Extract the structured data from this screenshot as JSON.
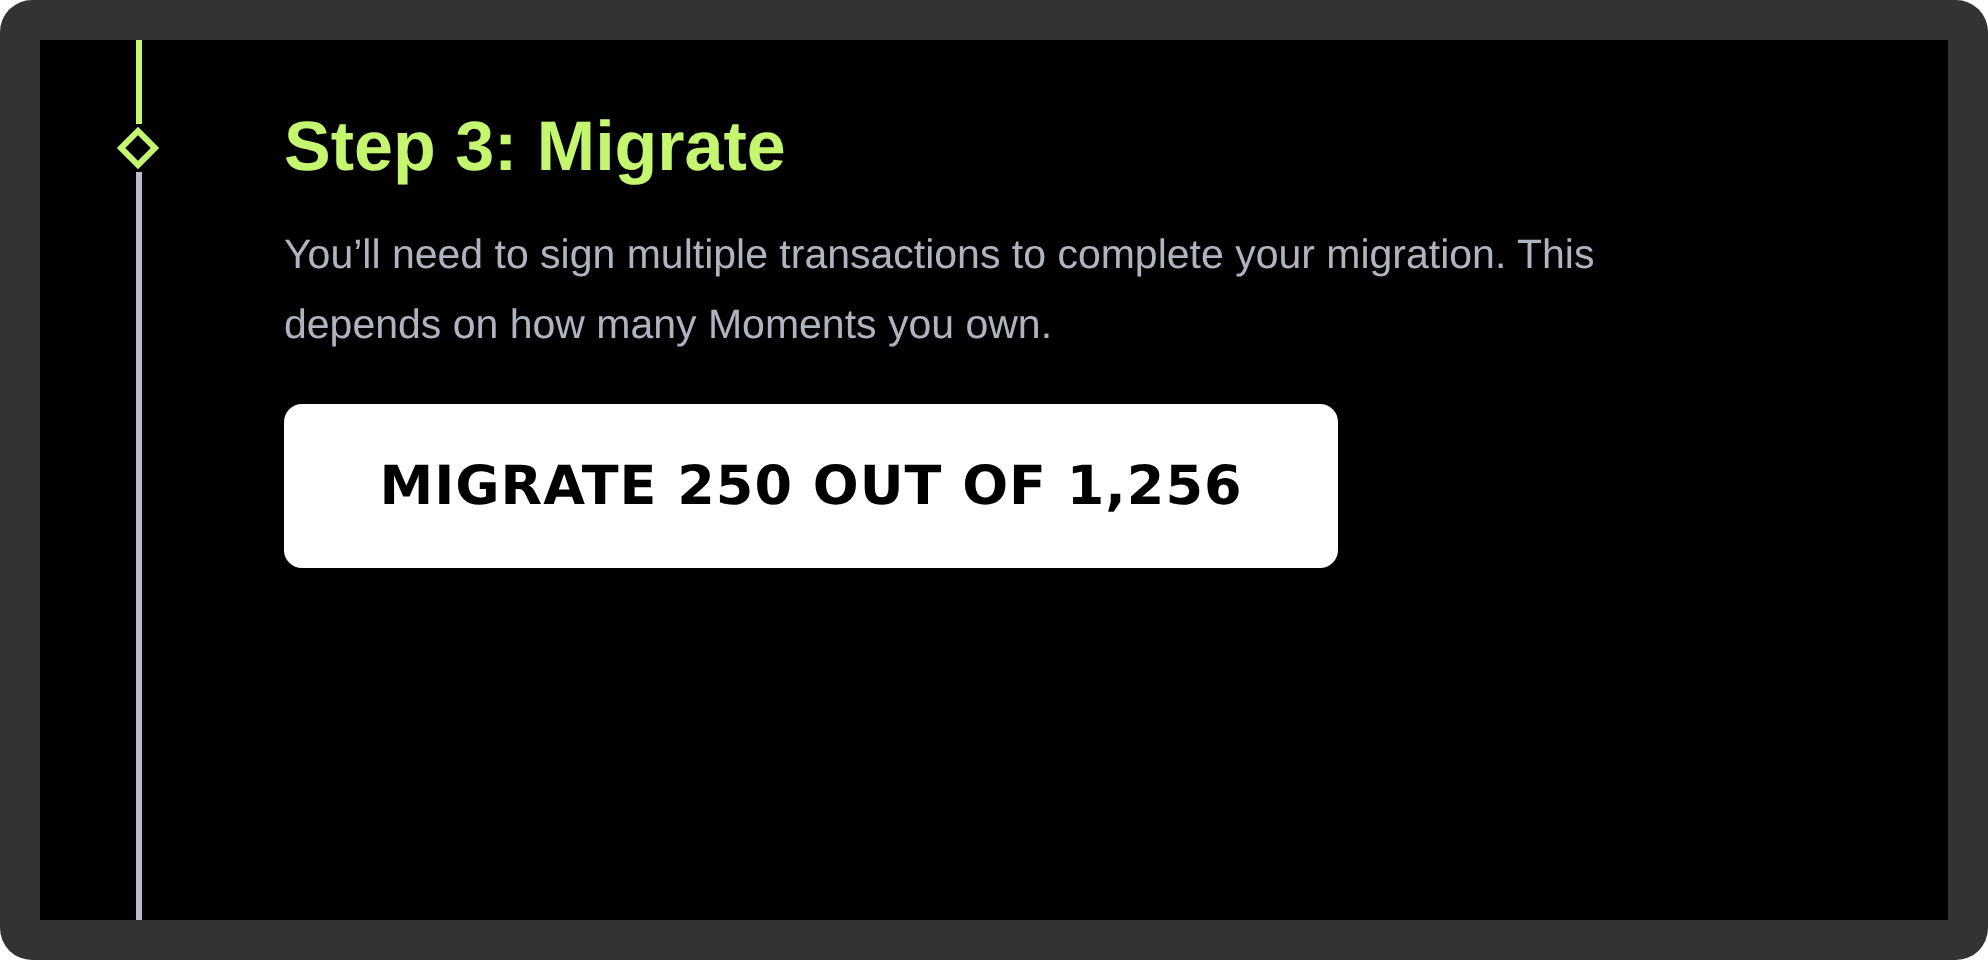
{
  "step": {
    "title": "Step 3: Migrate",
    "active": true,
    "description": "You’ll need to sign multiple transactions to complete your migration. This depends on how many Moments you own.",
    "button": "MIGRATE 250 OUT OF 1,256"
  }
}
